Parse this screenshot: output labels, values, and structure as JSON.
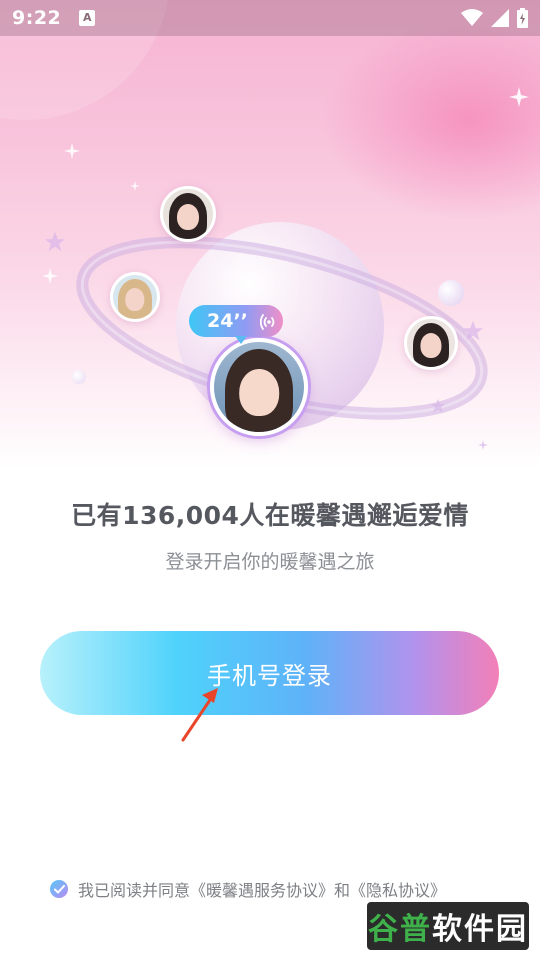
{
  "status_bar": {
    "time": "9:22",
    "notification_glyph": "A",
    "icons": [
      "wifi-icon",
      "signal-icon",
      "battery-icon"
    ]
  },
  "hero": {
    "voice_duration": "24’’",
    "avatars": [
      "avatar-girl-with-cat",
      "avatar-girl-flowers",
      "avatar-girl-right",
      "avatar-featured"
    ]
  },
  "headline": "已有136,004人在暖馨遇邂逅爱情",
  "subline": "登录开启你的暖馨遇之旅",
  "login_button": "手机号登录",
  "agreement": {
    "prefix": "我已阅读并同意",
    "service_link": "《暖馨遇服务协议》",
    "conjunction": "和",
    "privacy_link": "《隐私协议》",
    "checked": true
  },
  "watermark": {
    "green_text": "谷普",
    "white_text": "软件园"
  },
  "colors": {
    "bg_pink": "#f6b3d2",
    "button_start": "#b8f1fb",
    "button_mid": "#4fd2fb",
    "button_end": "#f37fb8",
    "text_dark": "#55595f",
    "text_muted": "#8c8f94"
  }
}
